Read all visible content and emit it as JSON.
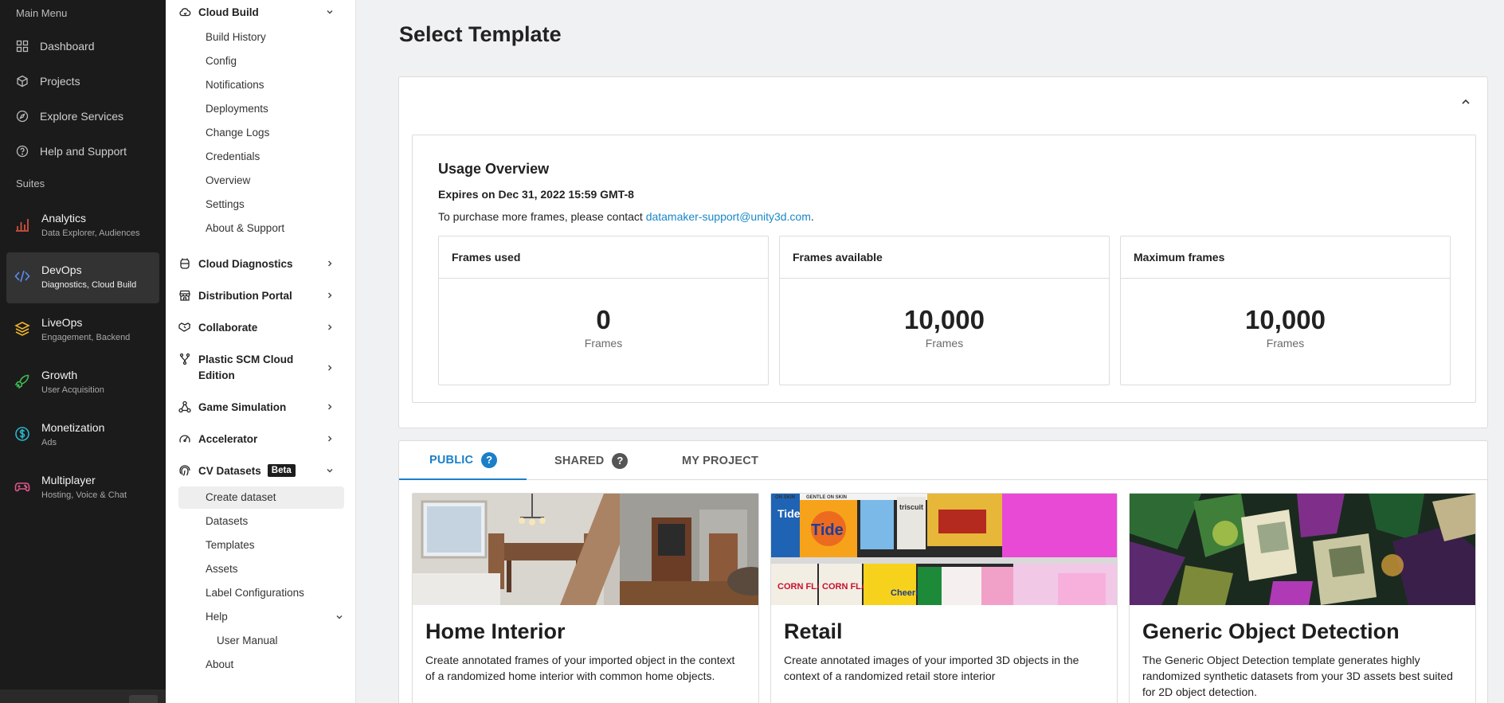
{
  "rail": {
    "main_menu_label": "Main Menu",
    "items": [
      {
        "label": "Dashboard",
        "icon": "dashboard-icon"
      },
      {
        "label": "Projects",
        "icon": "cube-icon"
      },
      {
        "label": "Explore Services",
        "icon": "compass-icon"
      },
      {
        "label": "Help and Support",
        "icon": "help-circle-icon"
      }
    ],
    "suites_label": "Suites",
    "suites": [
      {
        "title": "Analytics",
        "subtitle": "Data Explorer, Audiences",
        "icon": "bar-chart-icon",
        "color": "#e8573f"
      },
      {
        "title": "DevOps",
        "subtitle": "Diagnostics, Cloud Build",
        "icon": "code-icon",
        "color": "#5b8def"
      },
      {
        "title": "LiveOps",
        "subtitle": "Engagement, Backend",
        "icon": "layers-icon",
        "color": "#f0b429"
      },
      {
        "title": "Growth",
        "subtitle": "User Acquisition",
        "icon": "rocket-icon",
        "color": "#3fb950"
      },
      {
        "title": "Monetization",
        "subtitle": "Ads",
        "icon": "dollar-icon",
        "color": "#2bb5c9"
      },
      {
        "title": "Multiplayer",
        "subtitle": "Hosting, Voice & Chat",
        "icon": "gamepad-icon",
        "color": "#e0568a"
      }
    ]
  },
  "nav": {
    "cloud_build": "Cloud Build",
    "cloud_build_items": [
      "Build History",
      "Config",
      "Notifications",
      "Deployments",
      "Change Logs",
      "Credentials",
      "Overview",
      "Settings",
      "About & Support"
    ],
    "groups": [
      "Cloud Diagnostics",
      "Distribution Portal",
      "Collaborate",
      "Plastic SCM Cloud Edition",
      "Game Simulation",
      "Accelerator"
    ],
    "cv_datasets": "CV Datasets",
    "beta": "Beta",
    "cv_items": [
      "Create dataset",
      "Datasets",
      "Templates",
      "Assets",
      "Label Configurations"
    ],
    "help": "Help",
    "user_manual": "User Manual",
    "about": "About"
  },
  "main": {
    "title": "Select Template",
    "usage": {
      "title": "Usage Overview",
      "expires": "Expires on Dec 31, 2022 15:59 GMT-8",
      "contact_prefix": "To purchase more frames, please contact ",
      "contact_email": "datamaker-support@unity3d.com",
      "contact_suffix": ".",
      "stats": [
        {
          "label": "Frames used",
          "value": "0",
          "unit": "Frames"
        },
        {
          "label": "Frames available",
          "value": "10,000",
          "unit": "Frames"
        },
        {
          "label": "Maximum frames",
          "value": "10,000",
          "unit": "Frames"
        }
      ]
    },
    "tabs": [
      {
        "label": "PUBLIC",
        "help": "?"
      },
      {
        "label": "SHARED",
        "help": "?"
      },
      {
        "label": "MY PROJECT"
      }
    ],
    "templates": [
      {
        "title": "Home Interior",
        "desc": "Create annotated frames of your imported object in the context of a randomized home interior with common home objects."
      },
      {
        "title": "Retail",
        "desc": "Create annotated images of your imported 3D objects in the context of a randomized retail store interior"
      },
      {
        "title": "Generic Object Detection",
        "desc": "The Generic Object Detection template generates highly randomized synthetic datasets from your 3D assets best suited for 2D object detection."
      }
    ],
    "retail_image_text": [
      "Tide",
      "Tide",
      "triscuit",
      "CORN FLAKES",
      "CORN FLAKES",
      "Cheerios",
      "ON SKIN",
      "GENTLE ON SKIN"
    ]
  },
  "colors": {
    "accent": "#1a7fc8",
    "rail_bg": "#1b1b1b"
  }
}
